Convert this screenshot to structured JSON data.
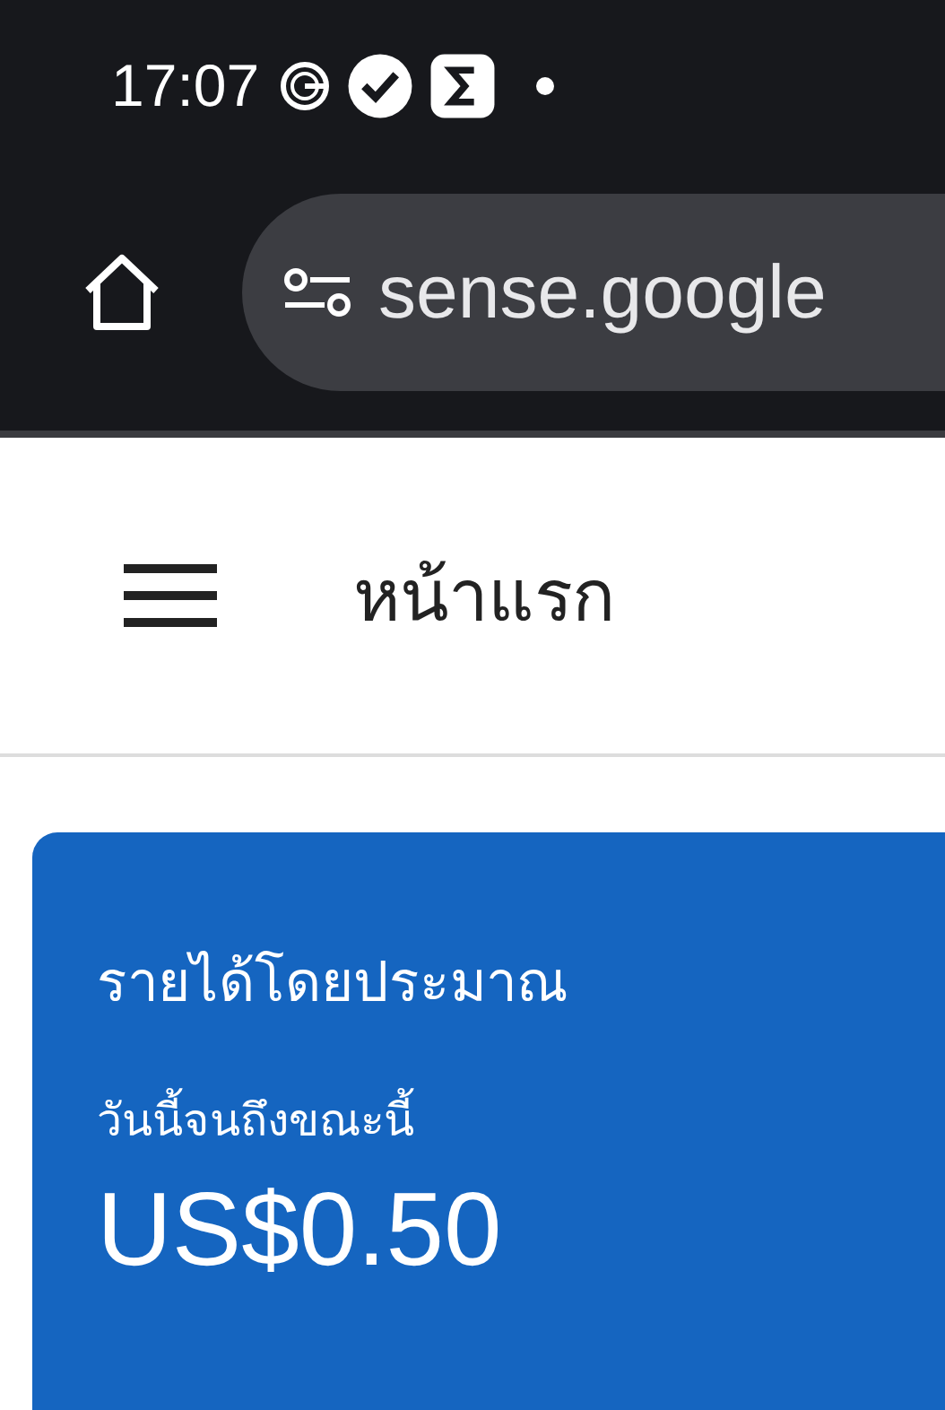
{
  "status_bar": {
    "time": "17:07"
  },
  "browser": {
    "url": "sense.google"
  },
  "header": {
    "title": "หน้าแรก"
  },
  "card": {
    "title": "รายได้โดยประมาณ",
    "period": "วันนี้จนถึงขณะนี้",
    "amount": "US$0.50"
  }
}
